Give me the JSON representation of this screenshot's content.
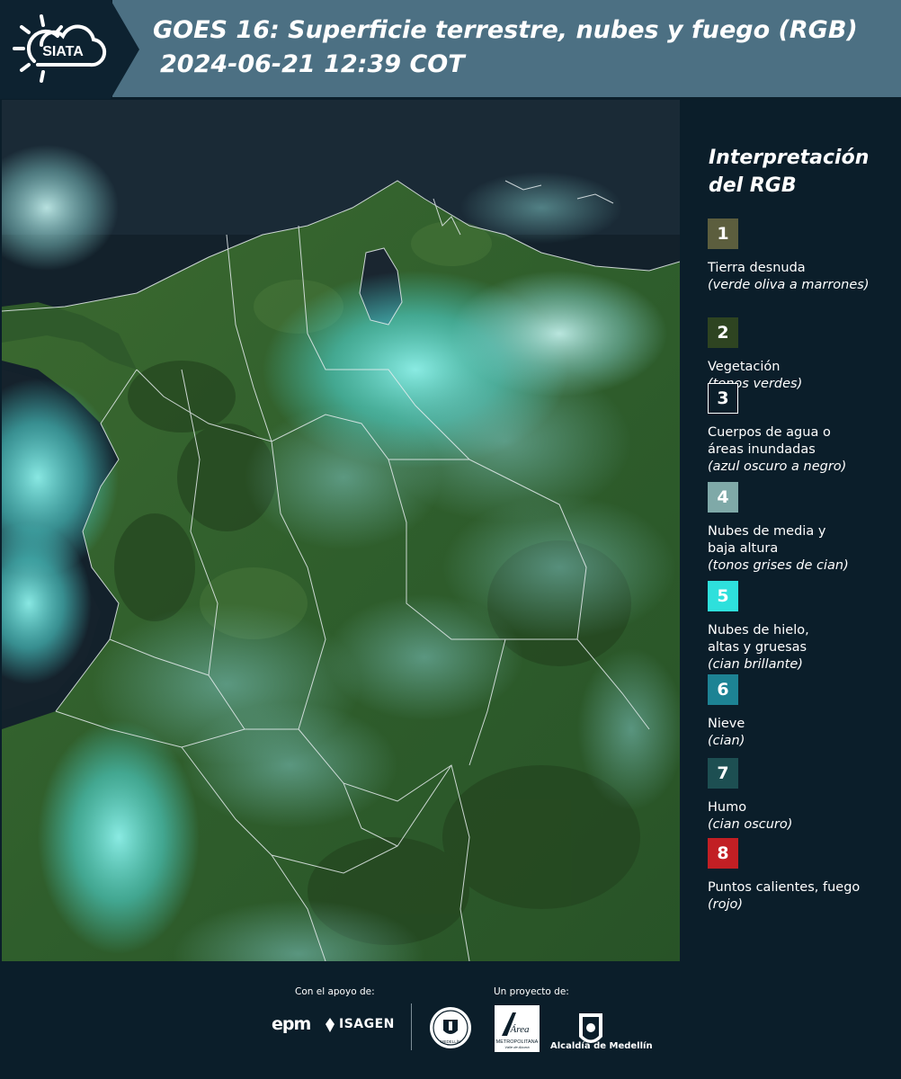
{
  "header": {
    "logo_text": "SIATA",
    "title_line1": "GOES 16: Superficie terrestre, nubes y fuego (RGB)",
    "title_line2": "2024-06-21 12:39 COT"
  },
  "map": {
    "icon": "satellite-rgb-composite-map"
  },
  "legend": {
    "title": "Interpretación del RGB",
    "items": [
      {
        "number": "1",
        "label": "Tierra desnuda",
        "desc": "(verde oliva a marrones)",
        "color": "#5c5e3e",
        "outlined": false
      },
      {
        "number": "2",
        "label": "Vegetación",
        "desc": "(tonos verdes)",
        "color": "#2e4421",
        "outlined": false
      },
      {
        "number": "3",
        "label": "Cuerpos de agua o\náreas inundadas",
        "desc": "(azul oscuro a negro)",
        "color": "#0b1e2a",
        "outlined": true
      },
      {
        "number": "4",
        "label": "Nubes de media y\nbaja altura",
        "desc": "(tonos grises de cian)",
        "color": "#7fa9a8",
        "outlined": false
      },
      {
        "number": "5",
        "label": "Nubes de hielo,\naltas y gruesas",
        "desc": "(cian brillante)",
        "color": "#2ee0dc",
        "outlined": false
      },
      {
        "number": "6",
        "label": "Nieve",
        "desc": "(cian)",
        "color": "#1d8394",
        "outlined": false
      },
      {
        "number": "7",
        "label": "Humo",
        "desc": "(cian oscuro)",
        "color": "#1d4f52",
        "outlined": false
      },
      {
        "number": "8",
        "label": "Puntos calientes, fuego",
        "desc": "(rojo)",
        "color": "#c21f24",
        "outlined": false
      }
    ]
  },
  "footer": {
    "support_caption": "Con el apoyo de:",
    "project_caption": "Un proyecto de:",
    "epm_logo": "epm",
    "isagen_logo": "ISAGEN",
    "medellin_seal_text": "MEDELLÍN",
    "amva_logo_text": "Área",
    "amva_logo_subtext": "METROPOLITANA",
    "amva_logo_tagline": "Valle de Aburrá",
    "alcaldia_name": "Alcaldía de Medellín"
  }
}
